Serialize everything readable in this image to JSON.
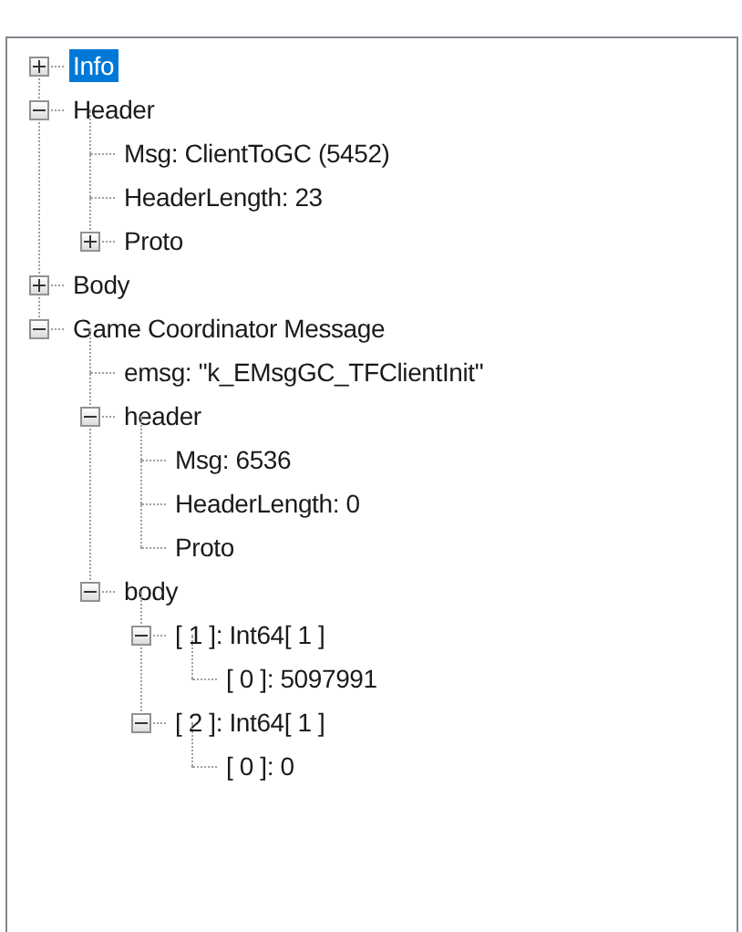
{
  "tree": {
    "nodes": [
      {
        "label": "Info",
        "selected": true,
        "expanded": false
      },
      {
        "label": "Header",
        "selected": false,
        "expanded": true,
        "children": [
          {
            "label": "Msg: ClientToGC (5452)",
            "selected": false
          },
          {
            "label": "HeaderLength: 23",
            "selected": false
          },
          {
            "label": "Proto",
            "selected": false,
            "expanded": false
          }
        ]
      },
      {
        "label": "Body",
        "selected": false,
        "expanded": false
      },
      {
        "label": "Game Coordinator Message",
        "selected": false,
        "expanded": true,
        "children": [
          {
            "label": "emsg: \"k_EMsgGC_TFClientInit\"",
            "selected": false
          },
          {
            "label": "header",
            "selected": false,
            "expanded": true,
            "children": [
              {
                "label": "Msg: 6536",
                "selected": false
              },
              {
                "label": "HeaderLength: 0",
                "selected": false
              },
              {
                "label": "Proto",
                "selected": false
              }
            ]
          },
          {
            "label": "body",
            "selected": false,
            "expanded": true,
            "children": [
              {
                "label": "[ 1 ]: Int64[ 1 ]",
                "selected": false,
                "expanded": true,
                "children": [
                  {
                    "label": "[ 0 ]: 5097991",
                    "selected": false
                  }
                ]
              },
              {
                "label": "[ 2 ]: Int64[ 1 ]",
                "selected": false,
                "expanded": true,
                "children": [
                  {
                    "label": "[ 0 ]: 0",
                    "selected": false
                  }
                ]
              }
            ]
          }
        ]
      }
    ]
  }
}
